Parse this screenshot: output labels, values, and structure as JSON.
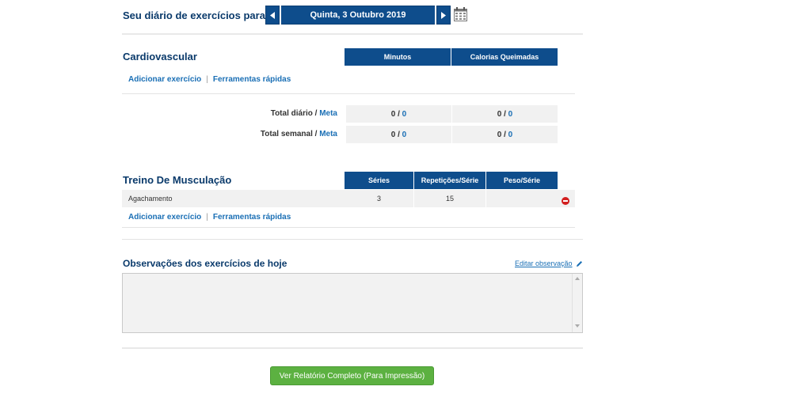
{
  "header": {
    "title": "Seu diário de exercícios para:",
    "date": "Quinta, 3 Outubro 2019",
    "prev_icon": "chevron-left-icon",
    "next_icon": "chevron-right-icon",
    "calendar_icon": "calendar-icon"
  },
  "cardio": {
    "title": "Cardiovascular",
    "columns": [
      "Minutos",
      "Calorias Queimadas"
    ],
    "add_link": "Adicionar exercício",
    "separator": "|",
    "quick_tools": "Ferramentas rápidas",
    "daily_label": "Total diário",
    "weekly_label": "Total semanal",
    "slash": " / ",
    "goal": "Meta",
    "daily": [
      {
        "value": "0",
        "goal": "0"
      },
      {
        "value": "0",
        "goal": "0"
      }
    ],
    "weekly": [
      {
        "value": "0",
        "goal": "0"
      },
      {
        "value": "0",
        "goal": "0"
      }
    ]
  },
  "strength": {
    "title": "Treino De Musculação",
    "columns": [
      "Séries",
      "Repetições/Série",
      "Peso/Série"
    ],
    "exercises": [
      {
        "name": "Agachamento",
        "series": "3",
        "reps": "15",
        "weight": ""
      }
    ],
    "add_link": "Adicionar exercício",
    "separator": "|",
    "quick_tools": "Ferramentas rápidas",
    "remove_icon": "remove-icon"
  },
  "notes": {
    "title": "Observações dos exercícios de hoje",
    "edit_link": "Editar observação",
    "edit_icon": "pencil-icon",
    "content": ""
  },
  "report_button": "Ver Relatório Completo (Para Impressão)"
}
